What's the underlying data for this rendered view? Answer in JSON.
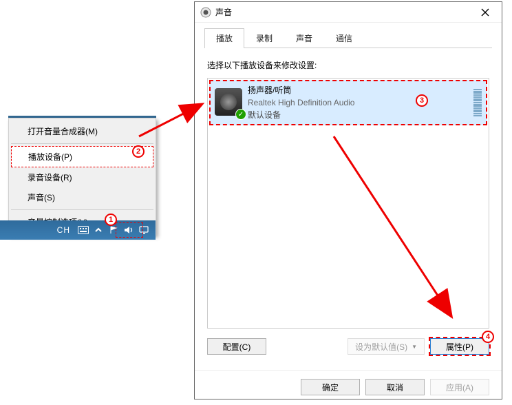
{
  "context_menu": {
    "items": [
      {
        "label": "打开音量合成器(M)"
      },
      {
        "label": "播放设备(P)"
      },
      {
        "label": "录音设备(R)"
      },
      {
        "label": "声音(S)"
      },
      {
        "label": "音量控制选项(V)"
      }
    ]
  },
  "taskbar": {
    "ime_label": "CH"
  },
  "dialog": {
    "title": "声音",
    "tabs": [
      {
        "label": "播放"
      },
      {
        "label": "录制"
      },
      {
        "label": "声音"
      },
      {
        "label": "通信"
      }
    ],
    "instruction": "选择以下播放设备来修改设置:",
    "device": {
      "name": "扬声器/听筒",
      "driver": "Realtek High Definition Audio",
      "status": "默认设备"
    },
    "buttons": {
      "configure": "配置(C)",
      "set_default": "设为默认值(S)",
      "properties": "属性(P)",
      "ok": "确定",
      "cancel": "取消",
      "apply": "应用(A)"
    }
  },
  "annotations": {
    "b1": "1",
    "b2": "2",
    "b3": "3",
    "b4": "4"
  }
}
